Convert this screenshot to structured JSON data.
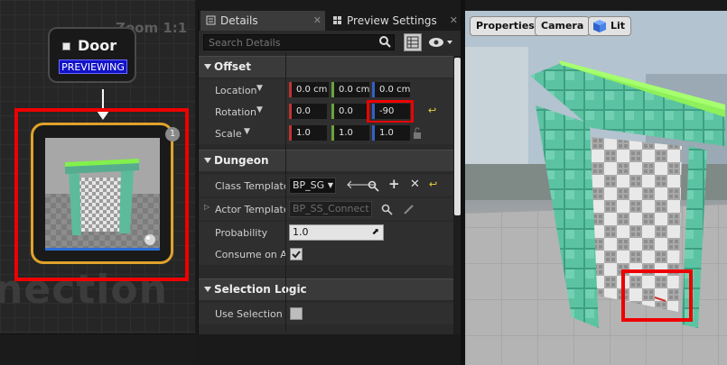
{
  "graph": {
    "zoom_label": "Zoom 1:1",
    "watermark_text": "nection",
    "door_node": {
      "title": "Door",
      "badge": "PREVIEWING"
    },
    "thumbnail_node": {
      "count": "1"
    }
  },
  "details": {
    "tabs": [
      {
        "label": "Details",
        "icon": "details-icon"
      },
      {
        "label": "Preview Settings",
        "icon": "grid-icon"
      }
    ],
    "search_placeholder": "Search Details",
    "offset": {
      "title": "Offset",
      "location": {
        "label": "Location",
        "x": "0.0 cm",
        "y": "0.0 cm",
        "z": "0.0 cm"
      },
      "rotation": {
        "label": "Rotation",
        "x": "0.0",
        "y": "0.0",
        "z": "-90"
      },
      "scale": {
        "label": "Scale",
        "x": "1.0",
        "y": "1.0",
        "z": "1.0"
      }
    },
    "dungeon": {
      "title": "Dungeon",
      "class_template": {
        "label": "Class Template",
        "value": "BP_SG"
      },
      "actor_template": {
        "label": "Actor Template",
        "value": "BP_SS_Connect"
      },
      "probability": {
        "label": "Probability",
        "value": "1.0"
      },
      "consume": {
        "label": "Consume on Att",
        "checked": true
      }
    },
    "selection_logic": {
      "title": "Selection Logic",
      "use_selection": {
        "label": "Use Selection L",
        "checked": false
      }
    }
  },
  "viewport": {
    "buttons": [
      "Properties",
      "Camera",
      "Lit"
    ]
  },
  "colors": {
    "highlight_red": "#e00000",
    "node_border": "#e0a22b",
    "badge_blue": "#1212c8",
    "door_teal": "#4fb79a",
    "door_top_green": "#7df04a"
  }
}
